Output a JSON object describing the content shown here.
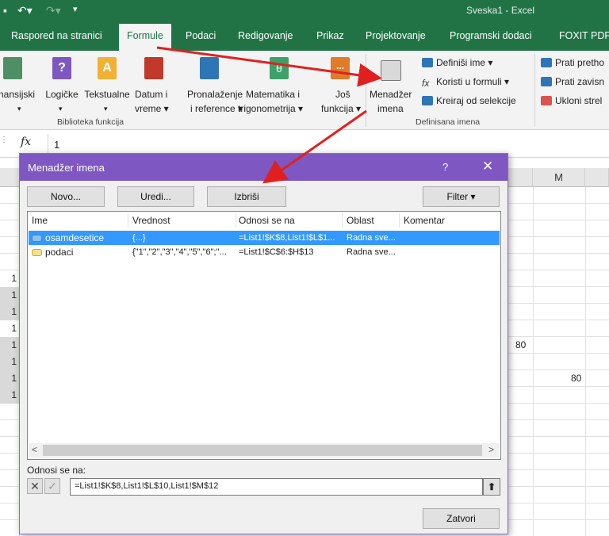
{
  "window": {
    "title": "Sveska1  -  Excel"
  },
  "tabs": [
    "Raspored na stranici",
    "Formule",
    "Podaci",
    "Redigovanje",
    "Prikaz",
    "Projektovanje",
    "Programski dodaci",
    "FOXIT PDF"
  ],
  "ribbon": {
    "function_library": {
      "buttons": [
        {
          "line1": "nansijski",
          "line2": "▾",
          "icon": "financial-icon",
          "color": "#4e8f63"
        },
        {
          "line1": "Logičke",
          "line2": "▾",
          "icon": "logical-icon",
          "color": "#7e57c2"
        },
        {
          "line1": "Tekstualne",
          "line2": "▾",
          "icon": "text-icon",
          "color": "#f2b134"
        },
        {
          "line1": "Datum i",
          "line2": "vreme ▾",
          "icon": "date-time-icon",
          "color": "#c0392b"
        },
        {
          "line1": "Pronalaženje",
          "line2": "i reference ▾",
          "icon": "lookup-icon",
          "color": "#2e75b6"
        },
        {
          "line1": "Matematika i",
          "line2": "trigonometrija ▾",
          "icon": "math-icon",
          "color": "#3f9f68"
        },
        {
          "line1": "Još",
          "line2": "funkcija ▾",
          "icon": "more-functions-icon",
          "color": "#e07b2a"
        }
      ],
      "group_label": "Biblioteka funkcija"
    },
    "defined_names": {
      "manager": {
        "line1": "Menadžer",
        "line2": "imena"
      },
      "define_name": "Definiši ime  ▾",
      "use_in_formula": "Koristi u formuli ▾",
      "create_from_selection": "Kreiraj od selekcije",
      "group_label": "Definisana imena"
    },
    "auditing": {
      "trace_precedents": "Prati pretho",
      "trace_dependents": "Prati zavisn",
      "remove_arrows": "Ukloni strel"
    }
  },
  "formula_bar": {
    "fx": "fx",
    "value": "1"
  },
  "sheet": {
    "col_m": "M",
    "row_values": [
      "1",
      "1",
      "1",
      "1",
      "1",
      "1",
      "1",
      "1"
    ],
    "cell_80_a": "80",
    "cell_80_b": "80"
  },
  "dialog": {
    "title": "Menadžer imena",
    "help": "?",
    "close": "✕",
    "buttons": {
      "new": "Novo...",
      "edit": "Uredi...",
      "delete": "Izbriši",
      "filter": "Filter ▾"
    },
    "columns": [
      "Ime",
      "Vrednost",
      "Odnosi se na",
      "Oblast",
      "Komentar"
    ],
    "rows": [
      {
        "name": "osamdesetice",
        "value": "{...}",
        "refers_to": "=List1!$K$8,List1!$L$1...",
        "scope": "Radna sve...",
        "comment": ""
      },
      {
        "name": "podaci",
        "value": "{\"1\",\"2\",\"3\",\"4\",\"5\",\"6\";\"...",
        "refers_to": "=List1!$C$6:$H$13",
        "scope": "Radna sve...",
        "comment": ""
      }
    ],
    "refers_label": "Odnosi se na:",
    "refers_value": "=List1!$K$8,List1!$L$10,List1!$M$12",
    "close_button": "Zatvori"
  }
}
